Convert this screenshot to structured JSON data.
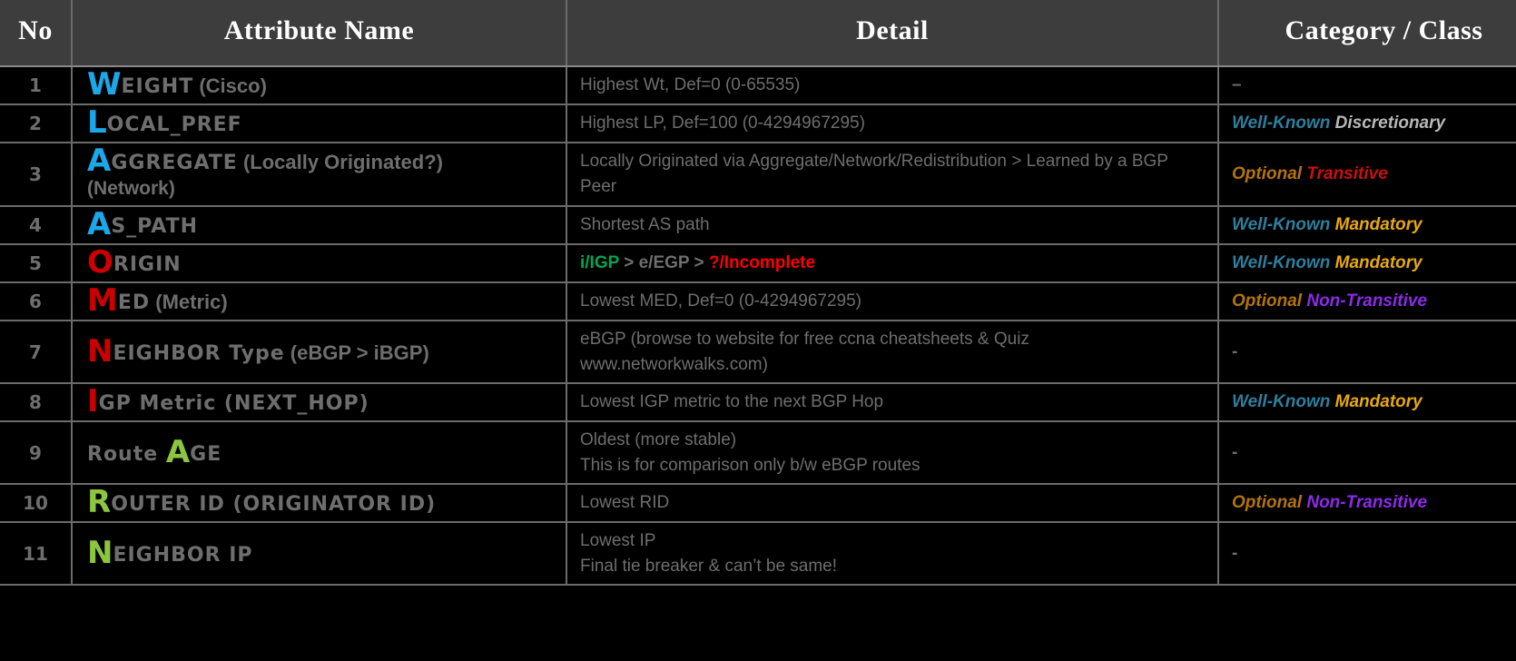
{
  "table": {
    "headers": {
      "no": "No",
      "name": "Attribute Name",
      "detail": "Detail",
      "category": "Category / Class"
    },
    "colors": {
      "header_bg": "#3d3d3d",
      "page_bg": "#000000",
      "body_text": "#6e6e6e",
      "grid_line": "#6b6b6b",
      "cyan": "#1BA7E8",
      "red": "#CC0000",
      "green": "#8CC63F",
      "well_known": "#2E7F9E",
      "mandatory": "#E8A90C",
      "discretionary": "#B8B8B8",
      "optional": "#B5730B",
      "transitive": "#CC1010",
      "non_transitive": "#8B2BE8",
      "igp_green": "#00A650",
      "incomplete_red": "#FF0000"
    },
    "rows": [
      {
        "no": "1",
        "cap": "W",
        "cap_color": "#1BA7E8",
        "rest": "EIGHT",
        "tail": " (Cisco)",
        "sub": "",
        "detail_lines": [
          "Highest Wt, Def=0 (0-65535)"
        ],
        "category": {
          "kind": "dash",
          "text": "–"
        }
      },
      {
        "no": "2",
        "cap": "L",
        "cap_color": "#1BA7E8",
        "rest": "OCAL_PREF",
        "tail": "",
        "sub": "",
        "detail_lines": [
          "Highest LP, Def=100 (0-4294967295)"
        ],
        "category": {
          "kind": "pair",
          "first": "Well-Known",
          "first_color": "#2E7F9E",
          "second": "Discretionary",
          "second_color": "#B8B8B8"
        }
      },
      {
        "no": "3",
        "cap": "A",
        "cap_color": "#1BA7E8",
        "rest": "GGREGATE",
        "tail": "  (Locally Originated?)",
        "sub": "(Network)",
        "detail_lines": [
          "Locally Originated  via Aggregate/Network/Redistribution   > Learned by a BGP Peer"
        ],
        "category": {
          "kind": "pair",
          "first": "Optional",
          "first_color": "#B5730B",
          "second": "Transitive",
          "second_color": "#CC1010"
        }
      },
      {
        "no": "4",
        "cap": "A",
        "cap_color": "#1BA7E8",
        "rest": "S_PATH",
        "tail": "",
        "sub": "",
        "detail_lines": [
          "Shortest AS path"
        ],
        "category": {
          "kind": "pair",
          "first": "Well-Known",
          "first_color": "#2E7F9E",
          "second": "Mandatory",
          "second_color": "#E8A90C"
        }
      },
      {
        "no": "5",
        "cap": "O",
        "cap_color": "#CC0000",
        "rest": "RIGIN",
        "tail": "",
        "sub": "",
        "detail_rich": [
          {
            "text": "i/IGP",
            "color": "#00A650"
          },
          {
            "text": " > e/EGP > ",
            "color": "#6e6e6e"
          },
          {
            "text": "?/Incomplete",
            "color": "#FF0000"
          }
        ],
        "detail_lines": [],
        "category": {
          "kind": "pair",
          "first": "Well-Known",
          "first_color": "#2E7F9E",
          "second": "Mandatory",
          "second_color": "#E8A90C"
        }
      },
      {
        "no": "6",
        "cap": "M",
        "cap_color": "#CC0000",
        "rest": "ED",
        "tail": " (Metric)",
        "sub": "",
        "detail_lines": [
          "Lowest MED, Def=0 (0-4294967295)"
        ],
        "category": {
          "kind": "pair",
          "first": "Optional",
          "first_color": "#B5730B",
          "second": "Non-Transitive",
          "second_color": "#8B2BE8"
        }
      },
      {
        "no": "7",
        "cap": "N",
        "cap_color": "#CC0000",
        "rest": "EIGHBOR Type",
        "tail": " (eBGP > iBGP)",
        "sub": "",
        "detail_lines": [
          "eBGP (browse to website for free ccna cheatsheets & Quiz",
          "www.networkwalks.com)"
        ],
        "category": {
          "kind": "dash",
          "text": "-"
        }
      },
      {
        "no": "8",
        "cap": "I",
        "cap_color": "#CC0000",
        "rest": "GP Metric (NEXT_HOP)",
        "tail": "",
        "sub": "",
        "detail_lines": [
          "Lowest IGP metric to the next BGP Hop"
        ],
        "category": {
          "kind": "pair",
          "first": "Well-Known",
          "first_color": "#2E7F9E",
          "second": "Mandatory",
          "second_color": "#E8A90C"
        }
      },
      {
        "no": "9",
        "pre": "Route ",
        "cap": "A",
        "cap_color": "#8CC63F",
        "rest": "GE",
        "tail": "",
        "sub": "",
        "detail_lines": [
          "Oldest (more stable)",
          "This is for comparison only b/w eBGP routes"
        ],
        "category": {
          "kind": "dash",
          "text": "-"
        }
      },
      {
        "no": "10",
        "cap": "R",
        "cap_color": "#8CC63F",
        "rest": "OUTER ID (ORIGINATOR ID)",
        "tail": "",
        "sub": "",
        "detail_lines": [
          "Lowest RID"
        ],
        "category": {
          "kind": "pair",
          "first": "Optional",
          "first_color": "#B5730B",
          "second": "Non-Transitive",
          "second_color": "#8B2BE8"
        }
      },
      {
        "no": "11",
        "cap": "N",
        "cap_color": "#8CC63F",
        "rest": "EIGHBOR IP",
        "tail": "",
        "sub": "",
        "detail_lines": [
          "Lowest IP",
          "Final tie breaker & can’t be same!"
        ],
        "category": {
          "kind": "dash",
          "text": "-"
        }
      }
    ]
  }
}
